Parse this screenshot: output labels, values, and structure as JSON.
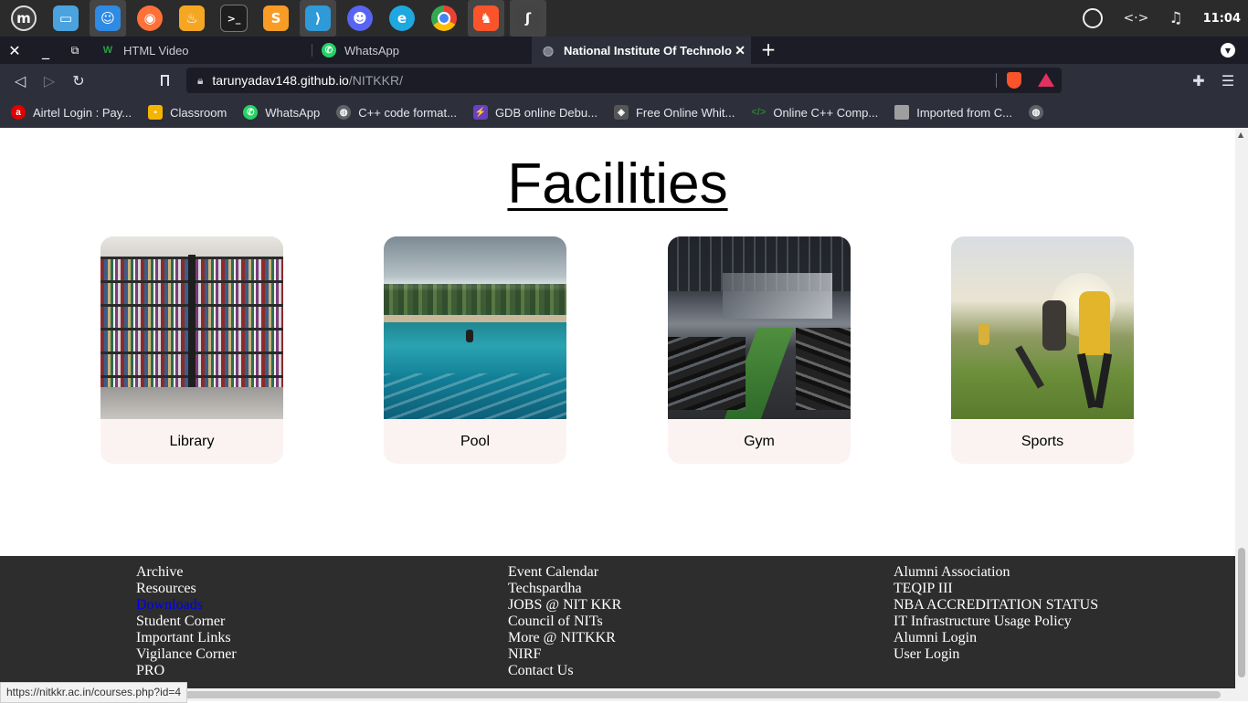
{
  "os": {
    "clock": "11:04",
    "apps": [
      {
        "name": "mint-menu-icon",
        "color": "#3d3d3d"
      },
      {
        "name": "files-icon",
        "color": "#4aa3df"
      },
      {
        "name": "finder-icon",
        "color": "#2f8ae3"
      },
      {
        "name": "firefox-icon",
        "color": "#ff7139"
      },
      {
        "name": "genie-icon",
        "color": "#f5a623"
      },
      {
        "name": "terminal-icon",
        "color": "#1e1e1e"
      },
      {
        "name": "sublime-icon",
        "color": "#f89c25"
      },
      {
        "name": "vscode-icon",
        "color": "#2f9ad8"
      },
      {
        "name": "discord-icon",
        "color": "#5865f2"
      },
      {
        "name": "edge-beta-icon",
        "color": "#1fa8e0"
      },
      {
        "name": "chrome-icon",
        "color": "#e94235"
      },
      {
        "name": "brave-icon",
        "color": "#fb542b"
      },
      {
        "name": "app-icon",
        "color": "#444444"
      }
    ]
  },
  "browser": {
    "tabs": [
      {
        "title": "HTML Video",
        "favicon": "W"
      },
      {
        "title": "WhatsApp",
        "favicon": "W"
      },
      {
        "title": "National Institute Of Technolo",
        "favicon": "globe"
      }
    ],
    "url_host": "tarunyadav148.github.io",
    "url_path": "/NITKKR/",
    "bookmarks": [
      {
        "label": "Airtel Login : Pay...",
        "color": "#e40000"
      },
      {
        "label": "Classroom",
        "color": "#f4b400"
      },
      {
        "label": "WhatsApp",
        "color": "#25d366"
      },
      {
        "label": "C++ code format...",
        "color": "#5f6368"
      },
      {
        "label": "GDB online Debu...",
        "color": "#6a40c0"
      },
      {
        "label": "Free Online Whit...",
        "color": "#555555"
      },
      {
        "label": "Online C++ Comp...",
        "color": "#2e7d32"
      },
      {
        "label": "Imported from C...",
        "color": "#9e9e9e"
      }
    ],
    "status_url": "https://nitkkr.ac.in/courses.php?id=4"
  },
  "page": {
    "facilities_title": "Facilities",
    "facilities": [
      {
        "label": "Library",
        "image": "library-photo"
      },
      {
        "label": "Pool",
        "image": "pool-photo"
      },
      {
        "label": "Gym",
        "image": "gym-photo"
      },
      {
        "label": "Sports",
        "image": "sports-photo"
      }
    ],
    "footer": {
      "col1": [
        "Archive",
        "Resources",
        "Downloads",
        "Student Corner",
        "Important Links",
        "Vigilance Corner",
        "PRO"
      ],
      "col2": [
        "Event Calendar",
        "Techspardha",
        "JOBS @ NIT KKR",
        "Council of NITs",
        "More @ NITKKR",
        "NIRF",
        "Contact Us"
      ],
      "col3": [
        "Alumni Association",
        "TEQIP III",
        "NBA ACCREDITATION STATUS",
        "IT Infrastructure Usage Policy",
        "Alumni Login",
        "User Login"
      ]
    }
  }
}
